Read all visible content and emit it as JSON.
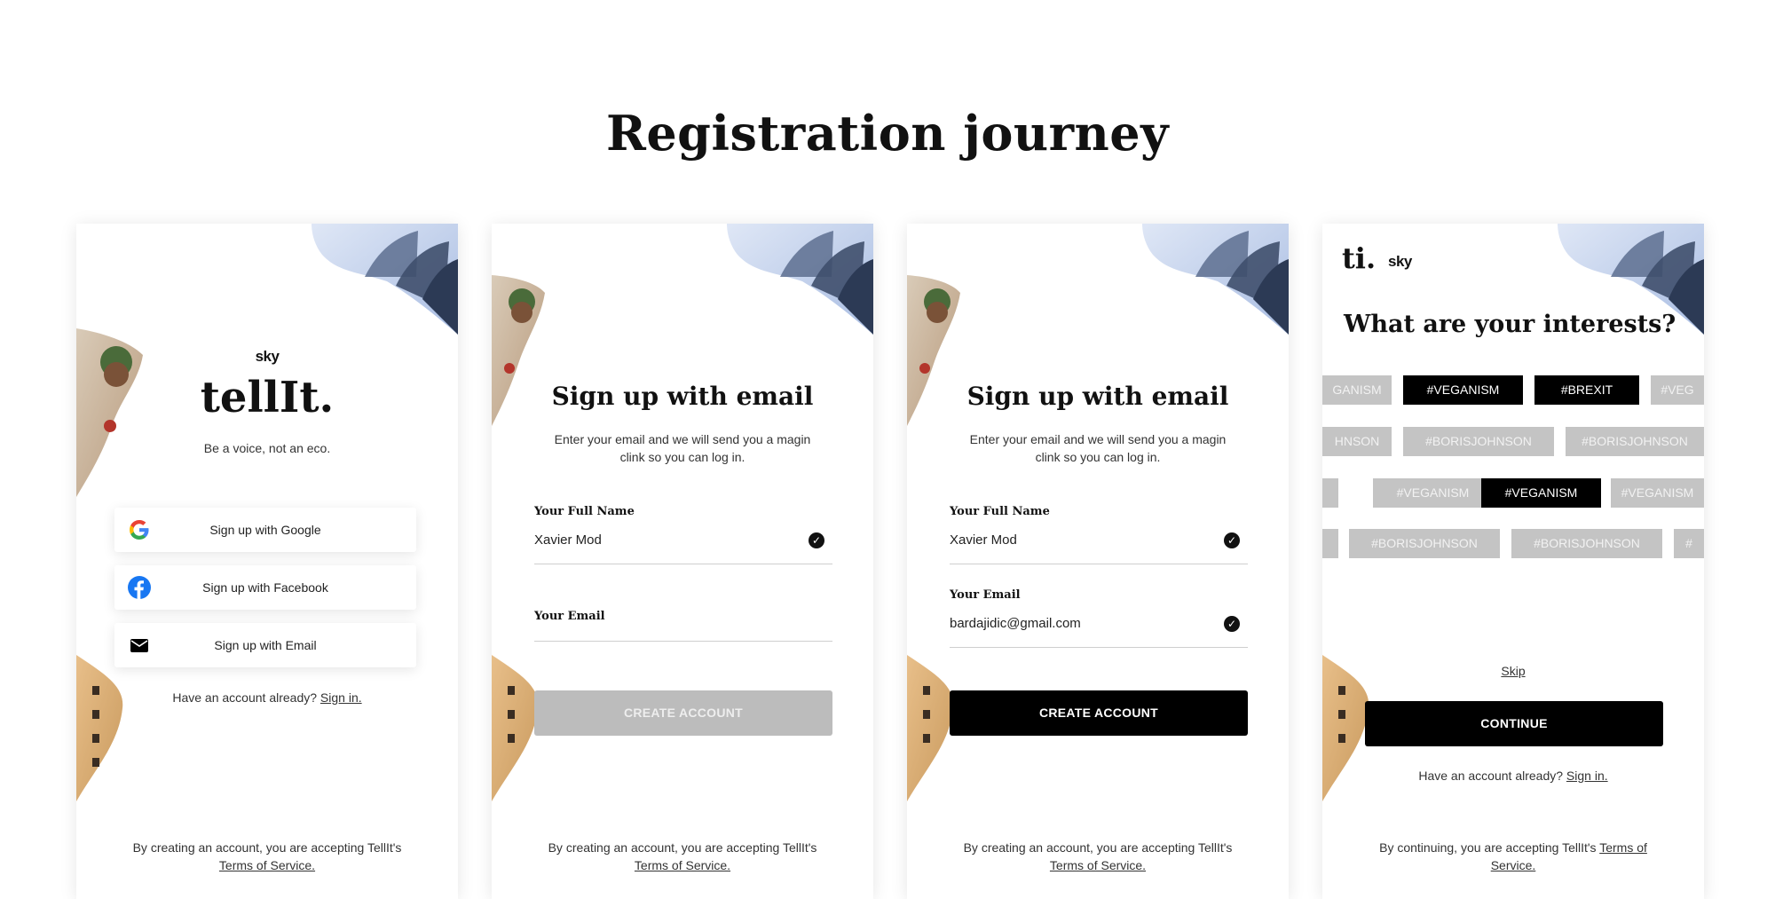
{
  "page": {
    "heading": "Registration journey"
  },
  "brand": {
    "sky": "sky",
    "app_name": "tellIt.",
    "short_logo": "ti."
  },
  "screen1": {
    "tagline": "Be a voice, not an eco.",
    "google_label": "Sign up with Google",
    "facebook_label": "Sign up with Facebook",
    "email_label": "Sign up with Email",
    "have_account": "Have an account already?",
    "sign_in": "Sign in.",
    "terms_text": "By creating an account, you are accepting TellIt's",
    "terms_link": "Terms of Service."
  },
  "screen2": {
    "title": "Sign up with email",
    "description": "Enter your email and we will send you a magin clink so you can log in.",
    "name_label": "Your Full Name",
    "name_value": "Xavier Mod",
    "email_label": "Your Email",
    "email_value": "",
    "create_label": "CREATE ACCOUNT",
    "terms_text": "By creating an account, you are accepting TellIt's",
    "terms_link": "Terms of Service."
  },
  "screen3": {
    "title": "Sign up with email",
    "description": "Enter your email and we will send you a magin clink so you can log in.",
    "name_label": "Your Full Name",
    "name_value": "Xavier Mod",
    "email_label": "Your Email",
    "email_value": "bardajidic@gmail.com",
    "create_label": "CREATE ACCOUNT",
    "terms_text": "By creating an account, you are accepting TellIt's",
    "terms_link": "Terms of Service."
  },
  "screen4": {
    "title": "What are your interests?",
    "tag_rows": [
      [
        {
          "text": "GANISM",
          "active": false
        },
        {
          "text": "#VEGANISM",
          "active": true
        },
        {
          "text": "#BREXIT",
          "active": true
        },
        {
          "text": "#VEG",
          "active": false
        }
      ],
      [
        {
          "text": "HNSON",
          "active": false
        },
        {
          "text": "#BORISJOHNSON",
          "active": false
        },
        {
          "text": "#BORISJOHNSON",
          "active": false
        }
      ],
      [
        {
          "text": "",
          "active": false
        },
        {
          "text": "#VEGANISM",
          "active": false
        },
        {
          "text": "#VEGANISM",
          "active": true
        },
        {
          "text": "#VEGANISM",
          "active": false
        }
      ],
      [
        {
          "text": "",
          "active": false
        },
        {
          "text": "#BORISJOHNSON",
          "active": false
        },
        {
          "text": "#BORISJOHNSON",
          "active": false
        },
        {
          "text": "#",
          "active": false
        }
      ]
    ],
    "skip": "Skip",
    "continue_label": "CONTINUE",
    "have_account": "Have an account already?",
    "sign_in": "Sign in.",
    "terms_text": "By continuing, you are accepting TellIt's",
    "terms_link": "Terms of Service."
  },
  "colors": {
    "primary": "#000000",
    "disabled": "#bcbcbc",
    "tag_inactive": "#c4c4c4",
    "sky_blue": "#c8d6ef"
  },
  "icons": [
    "google-icon",
    "facebook-icon",
    "mail-icon",
    "check-icon"
  ]
}
